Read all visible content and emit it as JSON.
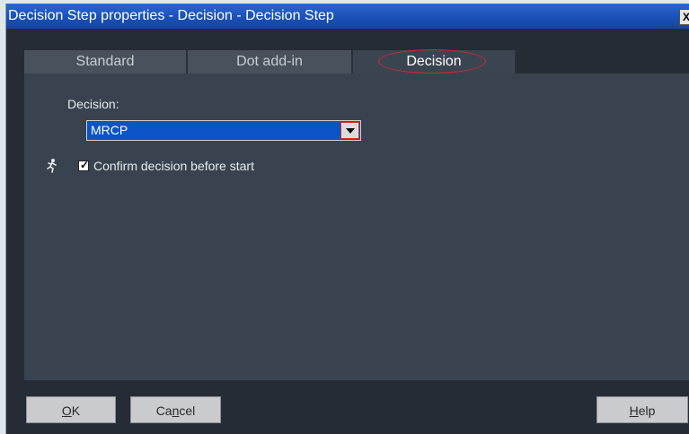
{
  "window": {
    "title": "Decision Step properties - Decision - Decision Step",
    "close_label": "X"
  },
  "tabs": [
    {
      "label": "Standard",
      "active": false
    },
    {
      "label": "Dot add-in",
      "active": false
    },
    {
      "label": "Decision",
      "active": true
    }
  ],
  "decision": {
    "label": "Decision:",
    "selected": "MRCP"
  },
  "confirm": {
    "label": "Confirm decision before start",
    "checked": true
  },
  "buttons": {
    "ok": {
      "pre": "",
      "mnemonic": "O",
      "post": "K"
    },
    "cancel": {
      "pre": "Ca",
      "mnemonic": "n",
      "post": "cel"
    },
    "help": {
      "pre": "",
      "mnemonic": "H",
      "post": "elp"
    }
  },
  "colors": {
    "titlebar": "#1a4fb5",
    "panel": "#394350",
    "selection": "#0a54c8",
    "annotation": "#d32a2a"
  }
}
